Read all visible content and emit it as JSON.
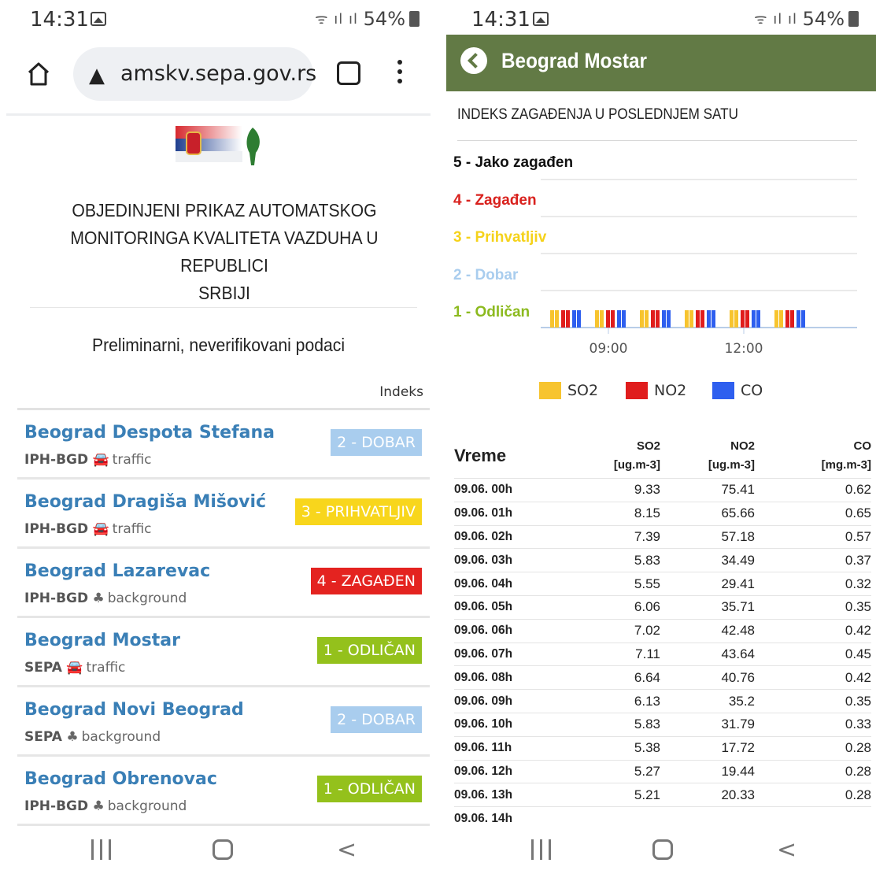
{
  "left": {
    "status": {
      "time": "14:31",
      "battery": "54%"
    },
    "browser": {
      "url": "amskv.sepa.gov.rs"
    },
    "page": {
      "title_lines": [
        "OBJEDINJENI PRIKAZ AUTOMATSKOG",
        "MONITORINGA KVALITETA VAZDUHA U REPUBLICI",
        "SRBIJI"
      ],
      "subtitle": "Preliminarni, neverifikovani podaci",
      "column_header": "Indeks",
      "stations": [
        {
          "name": "Beograd Despota Stefana",
          "org": "IPH-BGD",
          "type": "traffic",
          "type_icon": "car-icon",
          "index": "2 - DOBAR",
          "color": "#a9cdee"
        },
        {
          "name": "Beograd Dragiša Mišović",
          "org": "IPH-BGD",
          "type": "traffic",
          "type_icon": "car-icon",
          "index": "3 - PRIHVATLJIV",
          "color": "#f8d61c"
        },
        {
          "name": "Beograd Lazarevac",
          "org": "IPH-BGD",
          "type": "background",
          "type_icon": "tree-icon",
          "index": "4 - ZAGAĐEN",
          "color": "#e42320"
        },
        {
          "name": "Beograd Mostar",
          "org": "SEPA",
          "type": "traffic",
          "type_icon": "car-icon",
          "index": "1 - ODLIČAN",
          "color": "#94c11c"
        },
        {
          "name": "Beograd Novi Beograd",
          "org": "SEPA",
          "type": "background",
          "type_icon": "tree-icon",
          "index": "2 - DOBAR",
          "color": "#a9cdee"
        },
        {
          "name": "Beograd Obrenovac",
          "org": "IPH-BGD",
          "type": "background",
          "type_icon": "tree-icon",
          "index": "1 - ODLIČAN",
          "color": "#94c11c"
        }
      ]
    }
  },
  "right": {
    "status": {
      "time": "14:31",
      "battery": "54%"
    },
    "app": {
      "title": "Beograd Mostar",
      "accent": "#627a45"
    },
    "index_title": "INDEKS ZAGAĐENJA U POSLEDNJEM SATU",
    "levels": [
      {
        "label": "5 - Jako zagađen",
        "color": "#111111"
      },
      {
        "label": "4 - Zagađen",
        "color": "#d9221e"
      },
      {
        "label": "3 - Prihvatljiv",
        "color": "#f5d21a"
      },
      {
        "label": "2 - Dobar",
        "color": "#a9cdee"
      },
      {
        "label": "1 - Odličan",
        "color": "#8cba1f"
      }
    ],
    "chart_data": {
      "type": "bar",
      "title": "",
      "x_tick_labels": [
        "09:00",
        "12:00"
      ],
      "groups": 6,
      "series": [
        {
          "name": "SO2",
          "color": "#f7c42f",
          "values": [
            1,
            1,
            1,
            1,
            1,
            1
          ]
        },
        {
          "name": "NO2",
          "color": "#e01d1d",
          "values": [
            1,
            1,
            1,
            1,
            1,
            1
          ]
        },
        {
          "name": "CO",
          "color": "#2e5fef",
          "values": [
            1,
            1,
            1,
            1,
            1,
            1
          ]
        }
      ],
      "ylim": [
        0,
        5
      ],
      "legend": "bottom"
    },
    "table": {
      "headers": {
        "time": "Vreme",
        "so2": "SO2",
        "so2_unit": "[ug.m-3]",
        "no2": "NO2",
        "no2_unit": "[ug.m-3]",
        "co": "CO",
        "co_unit": "[mg.m-3]"
      },
      "rows": [
        {
          "time": "09.06. 00h",
          "so2": "9.33",
          "no2": "75.41",
          "co": "0.62"
        },
        {
          "time": "09.06. 01h",
          "so2": "8.15",
          "no2": "65.66",
          "co": "0.65"
        },
        {
          "time": "09.06. 02h",
          "so2": "7.39",
          "no2": "57.18",
          "co": "0.57"
        },
        {
          "time": "09.06. 03h",
          "so2": "5.83",
          "no2": "34.49",
          "co": "0.37"
        },
        {
          "time": "09.06. 04h",
          "so2": "5.55",
          "no2": "29.41",
          "co": "0.32"
        },
        {
          "time": "09.06. 05h",
          "so2": "6.06",
          "no2": "35.71",
          "co": "0.35"
        },
        {
          "time": "09.06. 06h",
          "so2": "7.02",
          "no2": "42.48",
          "co": "0.42"
        },
        {
          "time": "09.06. 07h",
          "so2": "7.11",
          "no2": "43.64",
          "co": "0.45"
        },
        {
          "time": "09.06. 08h",
          "so2": "6.64",
          "no2": "40.76",
          "co": "0.42"
        },
        {
          "time": "09.06. 09h",
          "so2": "6.13",
          "no2": "35.2",
          "co": "0.35"
        },
        {
          "time": "09.06. 10h",
          "so2": "5.83",
          "no2": "31.79",
          "co": "0.33"
        },
        {
          "time": "09.06. 11h",
          "so2": "5.38",
          "no2": "17.72",
          "co": "0.28"
        },
        {
          "time": "09.06. 12h",
          "so2": "5.27",
          "no2": "19.44",
          "co": "0.28"
        },
        {
          "time": "09.06. 13h",
          "so2": "5.21",
          "no2": "20.33",
          "co": "0.28"
        },
        {
          "time": "09.06. 14h",
          "so2": "",
          "no2": "",
          "co": ""
        }
      ]
    }
  }
}
